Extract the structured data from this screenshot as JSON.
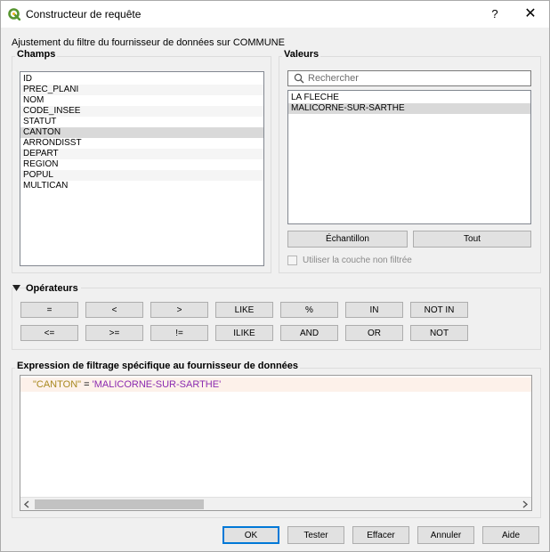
{
  "window": {
    "title": "Constructeur de requête",
    "help": "?",
    "close": "✕"
  },
  "subtitle": "Ajustement du filtre du fournisseur de données sur COMMUNE",
  "fields": {
    "title": "Champs",
    "items": [
      "ID",
      "PREC_PLANI",
      "NOM",
      "CODE_INSEE",
      "STATUT",
      "CANTON",
      "ARRONDISST",
      "DEPART",
      "REGION",
      "POPUL",
      "MULTICAN"
    ],
    "selected": "CANTON"
  },
  "values": {
    "title": "Valeurs",
    "search_placeholder": "Rechercher",
    "items": [
      "LA FLECHE",
      "MALICORNE-SUR-SARTHE"
    ],
    "selected": "MALICORNE-SUR-SARTHE",
    "sample_button": "Échantillon",
    "all_button": "Tout",
    "unfiltered_label": "Utiliser la couche non filtrée"
  },
  "operators": {
    "title": "Opérateurs",
    "row1": [
      "=",
      "<",
      ">",
      "LIKE",
      "%",
      "IN",
      "NOT IN"
    ],
    "row2": [
      "<=",
      ">=",
      "!=",
      "ILIKE",
      "AND",
      "OR",
      "NOT"
    ]
  },
  "expression": {
    "title": "Expression de filtrage spécifique au fournisseur de données",
    "field": "\"CANTON\"",
    "op": " = ",
    "value": "'MALICORNE-SUR-SARTHE'"
  },
  "footer": {
    "ok": "OK",
    "test": "Tester",
    "clear": "Effacer",
    "cancel": "Annuler",
    "help": "Aide"
  },
  "colors": {
    "accent": "#0078d7",
    "qgis_green": "#589632",
    "field_token": "#a8881f",
    "string_token": "#8b2bb0"
  }
}
